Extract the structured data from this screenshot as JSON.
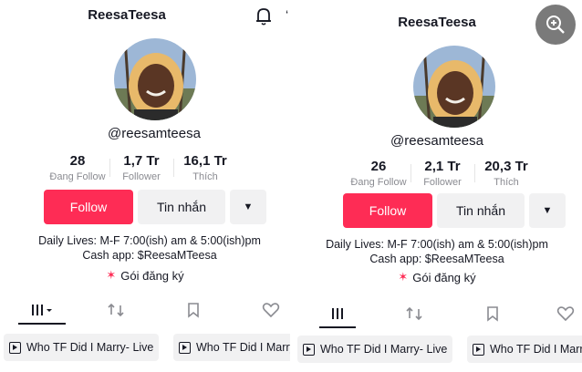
{
  "left": {
    "title": "ReesaTeesa",
    "handle": "@reesamteesa",
    "stats": [
      {
        "value": "28",
        "label": "Đang Follow"
      },
      {
        "value": "1,7 Tr",
        "label": "Follower"
      },
      {
        "value": "16,1 Tr",
        "label": "Thích"
      }
    ],
    "follow_label": "Follow",
    "message_label": "Tin nhắn",
    "more_label": "▼",
    "bio_line1": "Daily Lives: M-F 7:00(ish) am & 5:00(ish)pm",
    "bio_line2": "Cash app: $ReesaMTeesa",
    "subscription_label": "Gói đăng ký",
    "videos": [
      "Who TF Did I Marry- Live",
      "Who TF Did I Marry"
    ]
  },
  "right": {
    "title": "ReesaTeesa",
    "handle": "@reesamteesa",
    "stats": [
      {
        "value": "26",
        "label": "Đang Follow"
      },
      {
        "value": "2,1 Tr",
        "label": "Follower"
      },
      {
        "value": "20,3 Tr",
        "label": "Thích"
      }
    ],
    "follow_label": "Follow",
    "message_label": "Tin nhắn",
    "more_label": "▼",
    "bio_line1": "Daily Lives: M-F 7:00(ish) am & 5:00(ish)pm",
    "bio_line2": "Cash app: $ReesaMTeesa",
    "subscription_label": "Gói đăng ký",
    "videos": [
      "Who TF Did I Marry- Live",
      "Who TF Did I Marr"
    ]
  },
  "icons": {
    "bell": "bell-icon",
    "back": "chevron-left-icon",
    "zoom": "zoom-in-icon",
    "grid": "grid-icon",
    "repost": "repost-icon",
    "bookmark": "bookmark-icon",
    "heart": "heart-icon",
    "subscription": "sparkle-icon"
  },
  "colors": {
    "accent": "#fe2c55",
    "button_grey": "#f1f1f2",
    "muted_text": "#8a8b91"
  }
}
